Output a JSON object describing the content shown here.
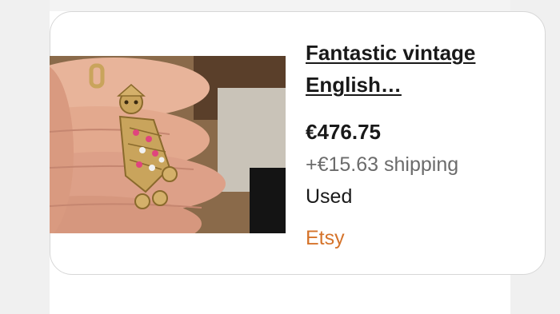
{
  "listing": {
    "title": "Fantastic vintage English…",
    "price": "€476.75",
    "shipping": "+€15.63 shipping",
    "condition": "Used",
    "seller": "Etsy",
    "image_alt": "gold clown pendant with pink and clear stones",
    "colors": {
      "seller": "#d5732a",
      "shipping": "#6b6b6b",
      "text": "#191919"
    }
  }
}
